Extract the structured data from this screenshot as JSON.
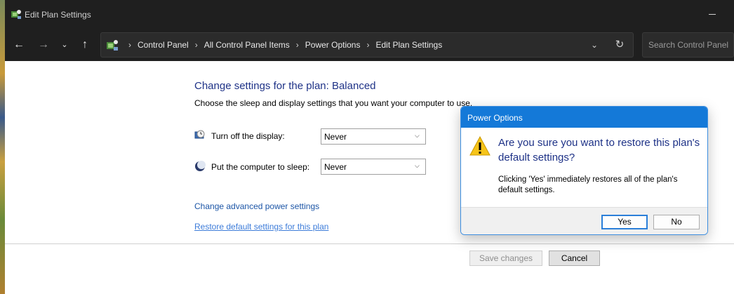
{
  "window": {
    "title": "Edit Plan Settings"
  },
  "nav": {
    "back_icon": "arrow-left-icon",
    "forward_icon": "arrow-right-icon",
    "recent_icon": "chevron-down-icon",
    "up_icon": "arrow-up-icon",
    "breadcrumbs": [
      "Control Panel",
      "All Control Panel Items",
      "Power Options",
      "Edit Plan Settings"
    ],
    "search_placeholder": "Search Control Panel"
  },
  "main": {
    "heading": "Change settings for the plan: Balanced",
    "subheading": "Choose the sleep and display settings that you want your computer to use.",
    "display": {
      "label": "Turn off the display:",
      "value": "Never"
    },
    "sleep": {
      "label": "Put the computer to sleep:",
      "value": "Never"
    },
    "advanced_link": "Change advanced power settings",
    "restore_link": "Restore default settings for this plan",
    "save_button": "Save changes",
    "cancel_button": "Cancel"
  },
  "dialog": {
    "title": "Power Options",
    "main_instruction": "Are you sure you want to restore this plan's default settings?",
    "content": "Clicking 'Yes' immediately restores all of the plan's default settings.",
    "yes_button": "Yes",
    "no_button": "No"
  },
  "colors": {
    "titlebar": "#1f1f1f",
    "heading_blue": "#1e3287",
    "link_blue": "#1c55a6",
    "dialog_title_bar": "#1479d8"
  }
}
